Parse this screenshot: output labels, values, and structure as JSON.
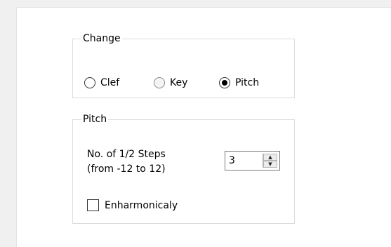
{
  "change_group": {
    "title": "Change",
    "options": [
      {
        "label": "Clef",
        "checked": false,
        "enabled": true
      },
      {
        "label": "Key",
        "checked": false,
        "enabled": false
      },
      {
        "label": "Pitch",
        "checked": true,
        "enabled": true
      }
    ]
  },
  "pitch_group": {
    "title": "Pitch",
    "steps_label_line1": "No. of 1/2 Steps",
    "steps_label_line2": "(from -12 to 12)",
    "steps_value": "3",
    "enharmonic_label": "Enharmonicaly",
    "enharmonic_checked": false
  }
}
